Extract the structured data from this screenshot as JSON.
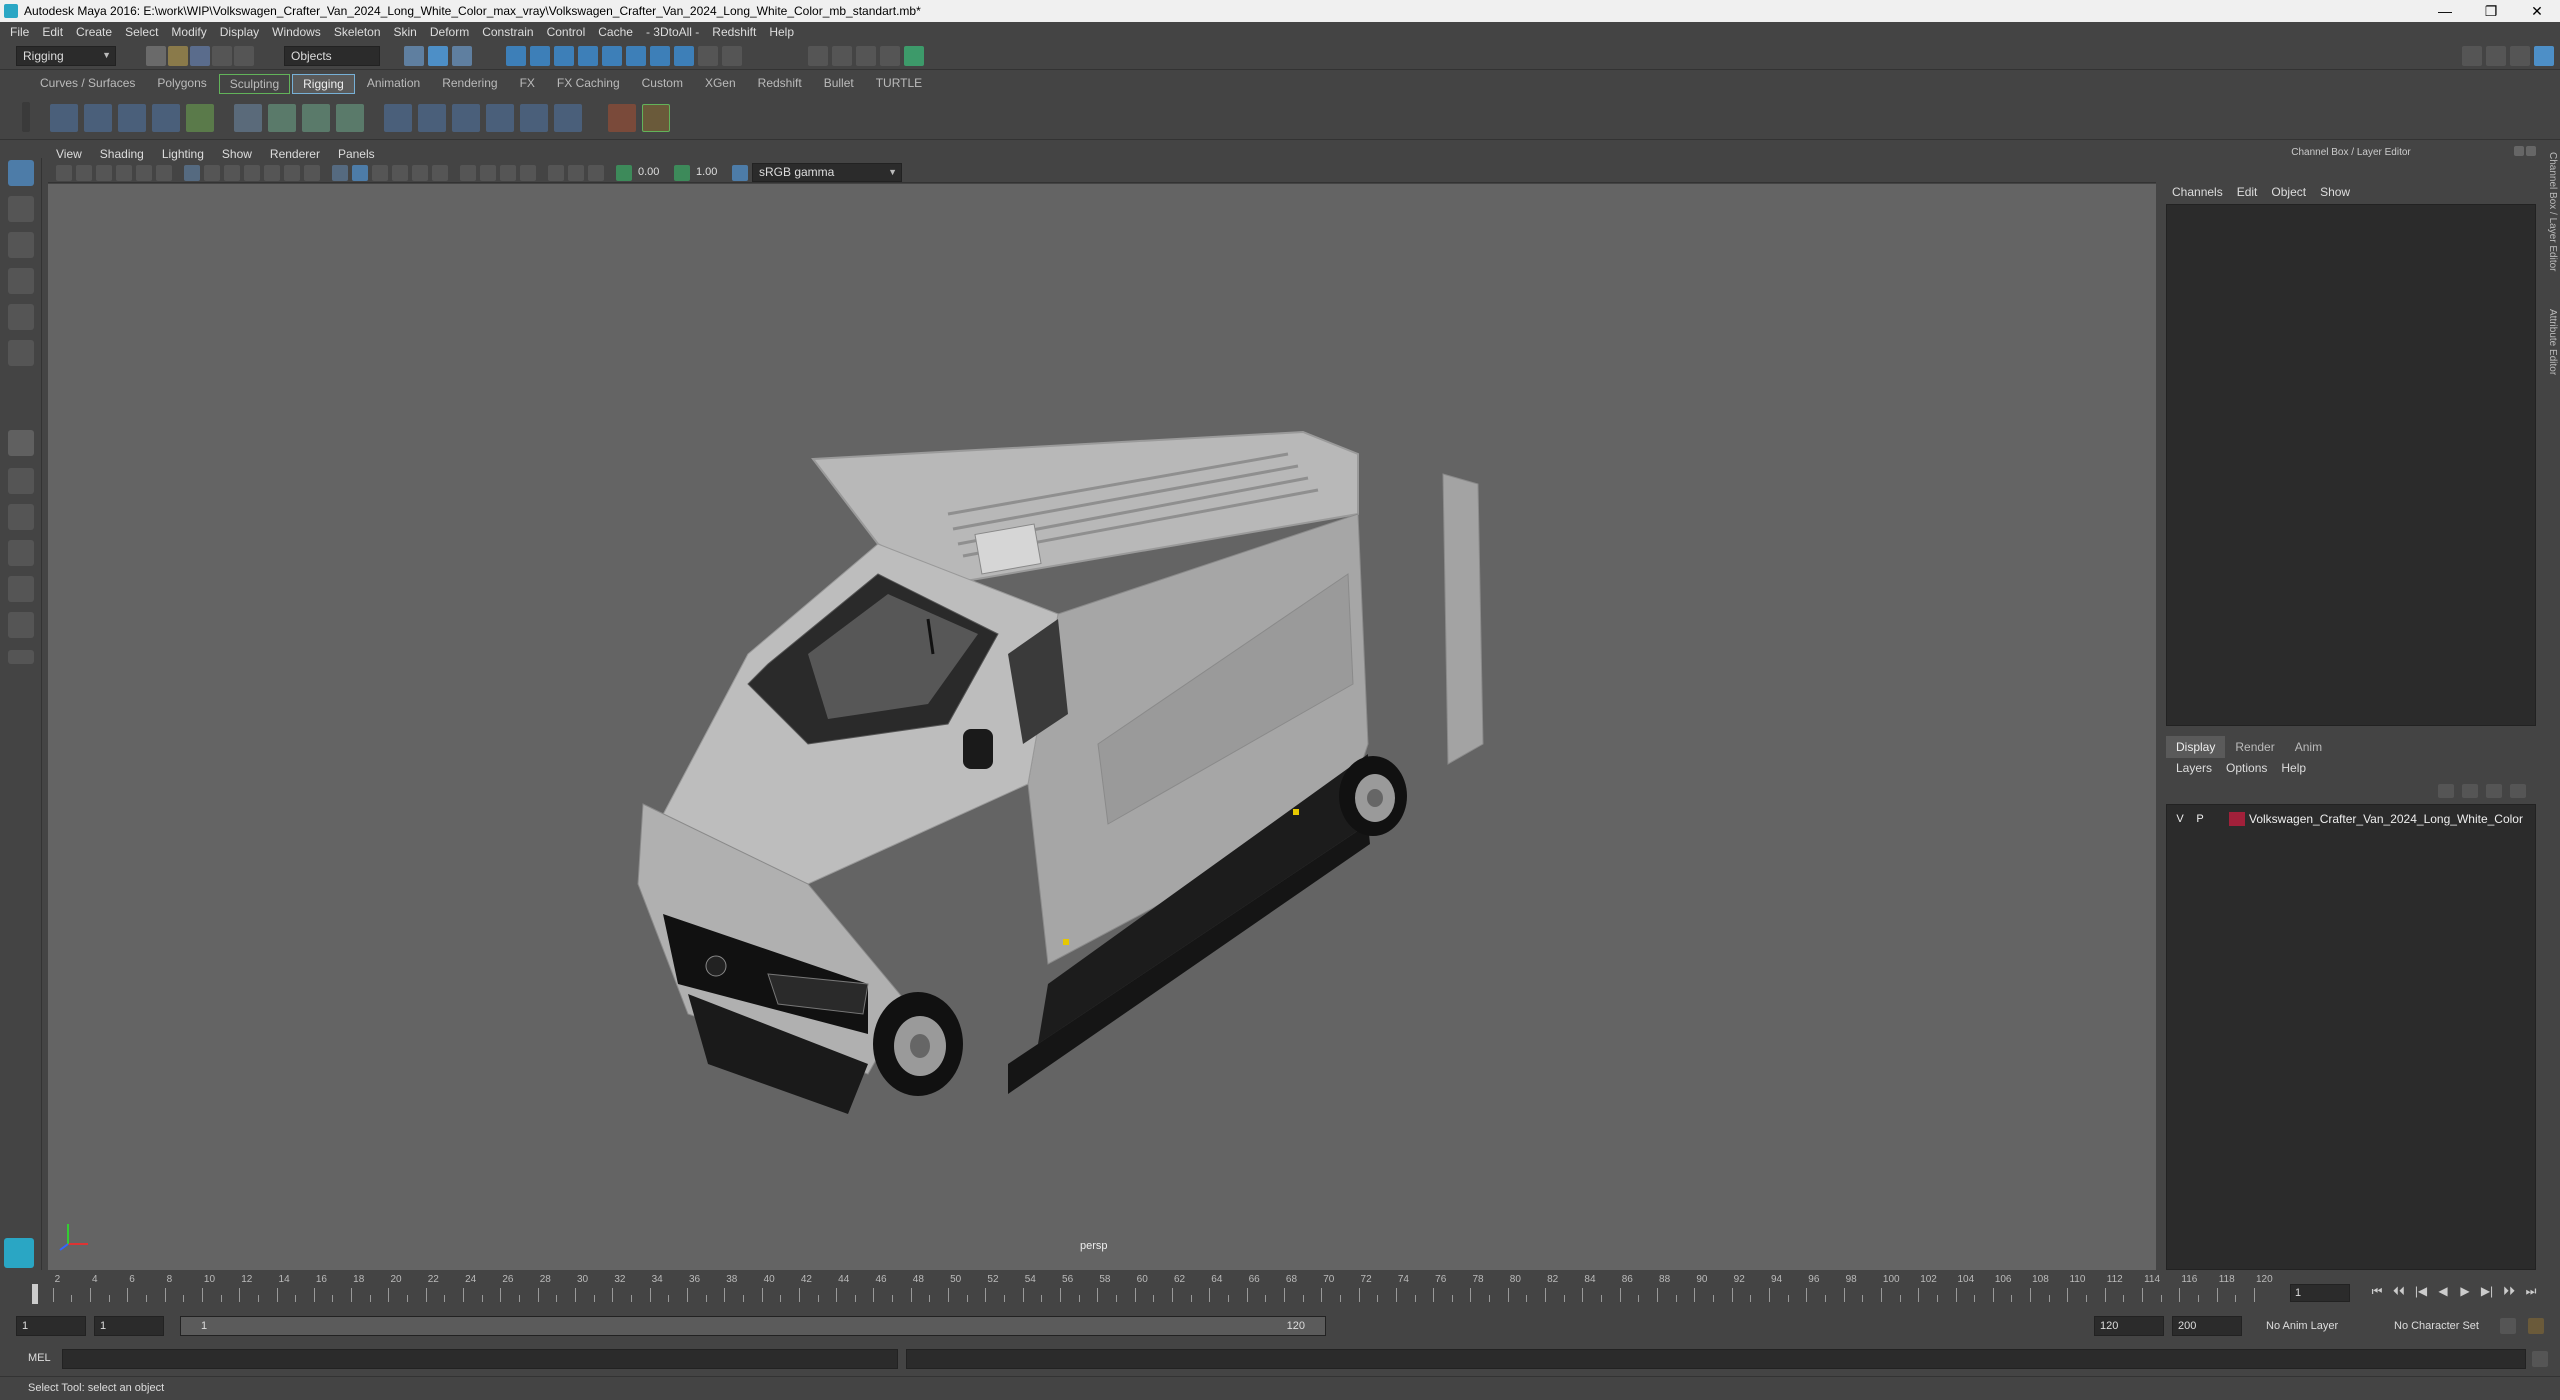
{
  "window": {
    "title": "Autodesk Maya 2016: E:\\work\\WIP\\Volkswagen_Crafter_Van_2024_Long_White_Color_max_vray\\Volkswagen_Crafter_Van_2024_Long_White_Color_mb_standart.mb*",
    "minimize": "—",
    "maximize": "❐",
    "close": "✕"
  },
  "menubar": [
    "File",
    "Edit",
    "Create",
    "Select",
    "Modify",
    "Display",
    "Windows",
    "Skeleton",
    "Skin",
    "Deform",
    "Constrain",
    "Control",
    "Cache",
    "- 3DtoAll -",
    "Redshift",
    "Help"
  ],
  "statusline": {
    "menuset": "Rigging",
    "selection_mode": "Objects"
  },
  "shelf_tabs": [
    {
      "label": "Curves / Surfaces",
      "active": false,
      "boxed": false
    },
    {
      "label": "Polygons",
      "active": false,
      "boxed": false
    },
    {
      "label": "Sculpting",
      "active": false,
      "boxed": true
    },
    {
      "label": "Rigging",
      "active": true,
      "boxed": true
    },
    {
      "label": "Animation",
      "active": false,
      "boxed": false
    },
    {
      "label": "Rendering",
      "active": false,
      "boxed": false
    },
    {
      "label": "FX",
      "active": false,
      "boxed": false
    },
    {
      "label": "FX Caching",
      "active": false,
      "boxed": false
    },
    {
      "label": "Custom",
      "active": false,
      "boxed": false
    },
    {
      "label": "XGen",
      "active": false,
      "boxed": false
    },
    {
      "label": "Redshift",
      "active": false,
      "boxed": false
    },
    {
      "label": "Bullet",
      "active": false,
      "boxed": false
    },
    {
      "label": "TURTLE",
      "active": false,
      "boxed": false
    }
  ],
  "panel_menu": [
    "View",
    "Shading",
    "Lighting",
    "Show",
    "Renderer",
    "Panels"
  ],
  "panel_tools": {
    "exposure": "0.00",
    "gamma": "1.00",
    "color_space": "sRGB gamma"
  },
  "viewport": {
    "camera_label": "persp"
  },
  "channel_box": {
    "header": "Channel Box / Layer Editor",
    "menu": [
      "Channels",
      "Edit",
      "Object",
      "Show"
    ]
  },
  "layer_editor": {
    "tabs": [
      "Display",
      "Render",
      "Anim"
    ],
    "active_tab": "Display",
    "menu": [
      "Layers",
      "Options",
      "Help"
    ],
    "layer": {
      "visible": "V",
      "playback": "P",
      "name": "Volkswagen_Crafter_Van_2024_Long_White_Color",
      "color": "#a1203a"
    }
  },
  "side_tabs": [
    "Channel Box / Layer Editor",
    "Attribute Editor"
  ],
  "timeline": {
    "tick_labels": [
      "2",
      "4",
      "6",
      "8",
      "10",
      "12",
      "14",
      "16",
      "18",
      "20",
      "22",
      "24",
      "26",
      "28",
      "30",
      "32",
      "34",
      "36",
      "38",
      "40",
      "42",
      "44",
      "46",
      "48",
      "50",
      "52",
      "54",
      "56",
      "58",
      "60",
      "62",
      "64",
      "66",
      "68",
      "70",
      "72",
      "74",
      "76",
      "78",
      "80",
      "82",
      "84",
      "86",
      "88",
      "90",
      "92",
      "94",
      "96",
      "98",
      "100",
      "102",
      "104",
      "106",
      "108",
      "110",
      "112",
      "114",
      "116",
      "118",
      "120"
    ],
    "current_frame": "1",
    "playback_buttons": [
      "⏮",
      "⏴⏴",
      "|◀",
      "◀",
      "▶",
      "▶|",
      "⏵⏵",
      "⏭"
    ]
  },
  "range": {
    "start": "1",
    "range_start": "1",
    "slider_low": "1",
    "slider_high": "120",
    "range_end": "120",
    "end": "200",
    "anim_layer": "No Anim Layer",
    "char_set": "No Character Set"
  },
  "cmdline": {
    "label": "MEL"
  },
  "helpline": {
    "text": "Select Tool: select an object"
  }
}
